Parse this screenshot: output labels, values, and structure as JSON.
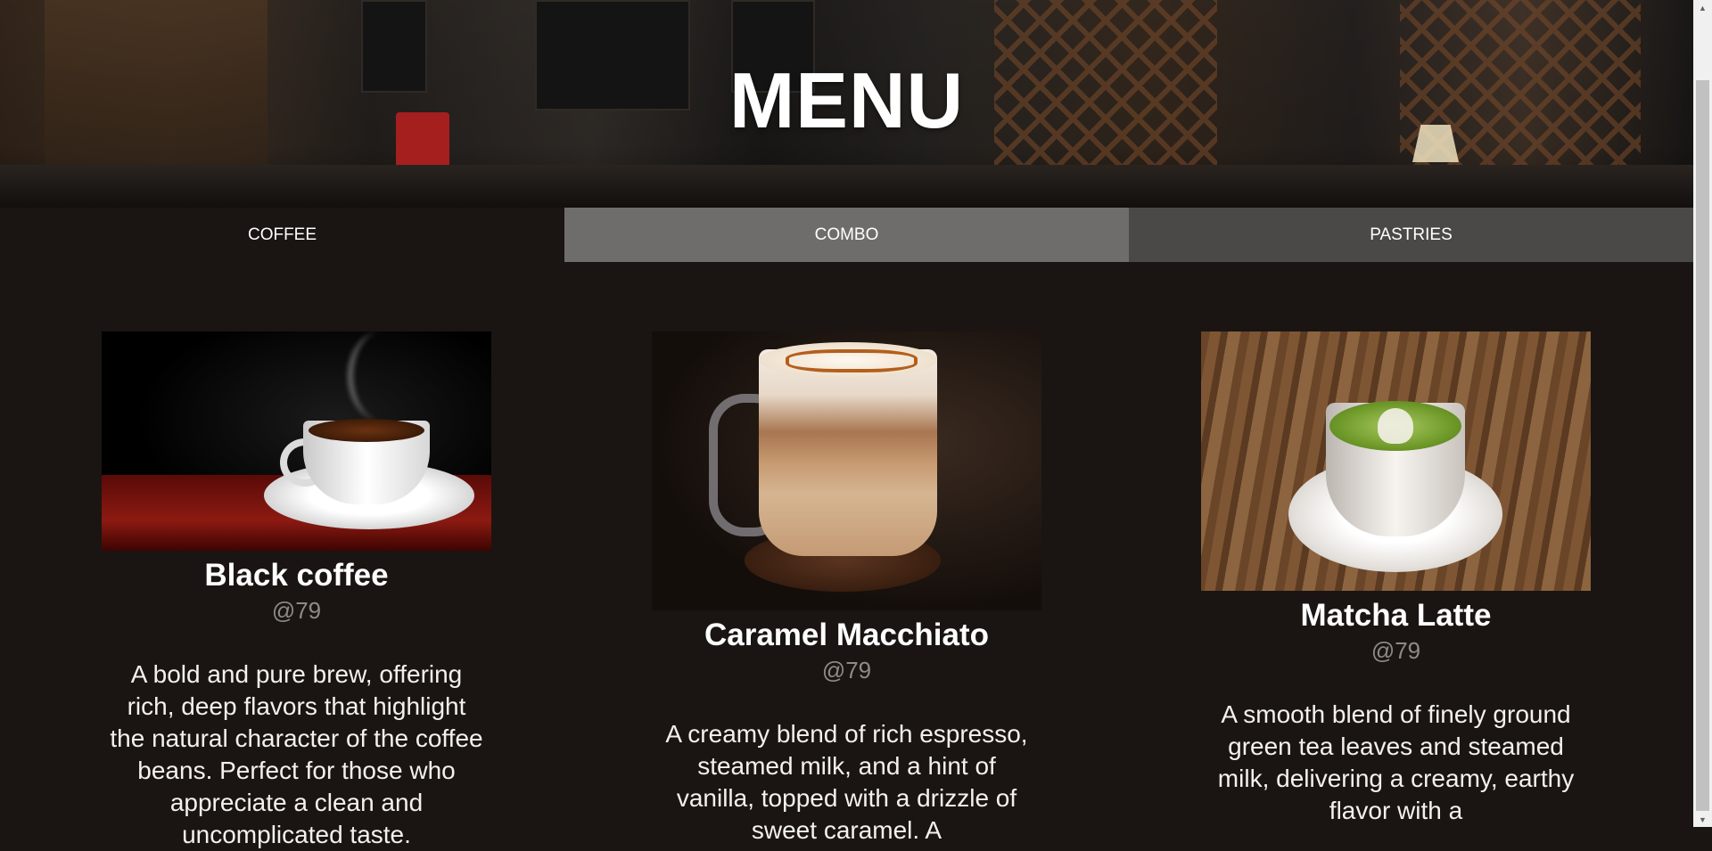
{
  "hero": {
    "title": "MENU"
  },
  "tabs": [
    {
      "label": "COFFEE"
    },
    {
      "label": "COMBO"
    },
    {
      "label": "PASTRIES"
    }
  ],
  "items": [
    {
      "name": "Black coffee",
      "price": "@79",
      "description": "A bold and pure brew, offering rich, deep flavors that highlight the natural character of the coffee beans. Perfect for those who appreciate a clean and uncomplicated taste."
    },
    {
      "name": "Caramel Macchiato",
      "price": "@79",
      "description": "A creamy blend of rich espresso, steamed milk, and a hint of vanilla, topped with a drizzle of sweet caramel. A"
    },
    {
      "name": "Matcha Latte",
      "price": "@79",
      "description": "A smooth blend of finely ground green tea leaves and steamed milk, delivering a creamy, earthy flavor with a"
    }
  ],
  "colors": {
    "page_bg": "#1a1512",
    "tab_active": "#1a1512",
    "tab_mid": "#6f6d6c",
    "tab_dark": "#4b4948",
    "price": "#8d8a87"
  },
  "icons": {
    "scroll_up": "triangle-up-icon",
    "scroll_down": "triangle-down-icon"
  }
}
